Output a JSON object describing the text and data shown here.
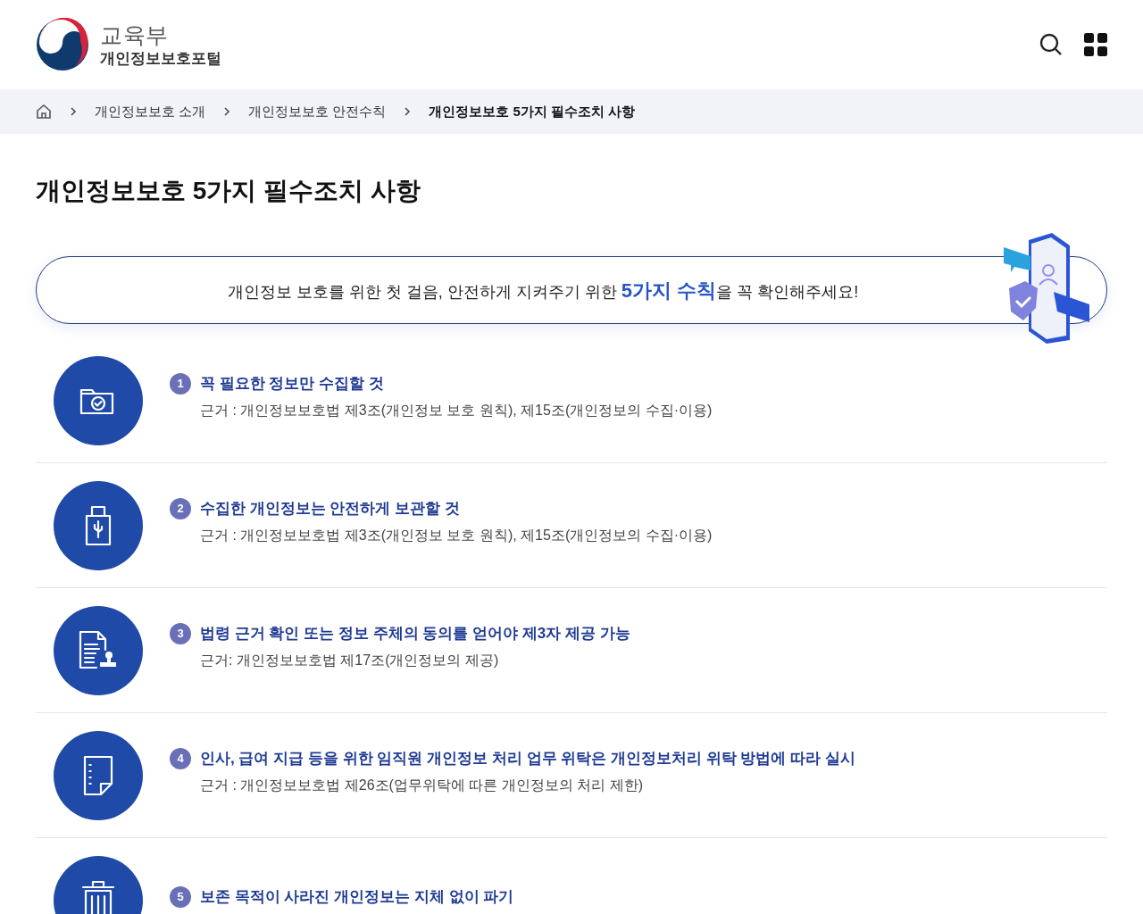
{
  "header": {
    "ministry": "교육부",
    "portal": "개인정보보호포털"
  },
  "breadcrumb": [
    {
      "label": "개인정보보호 소개",
      "current": false
    },
    {
      "label": "개인정보보호 안전수칙",
      "current": false
    },
    {
      "label": "개인정보보호 5가지 필수조치 사항",
      "current": true
    }
  ],
  "title": "개인정보보호 5가지 필수조치 사항",
  "banner": {
    "before": "개인정보 보호를 위한 첫 걸음, 안전하게 지켜주기 위한 ",
    "highlight": "5가지 수칙",
    "after": "을 꼭 확인해주세요!"
  },
  "items": [
    {
      "number": "1",
      "title": "꼭 필요한 정보만 수집할 것",
      "basis": "근거 : 개인정보보호법 제3조(개인정보 보호 원칙), 제15조(개인정보의 수집·이용)"
    },
    {
      "number": "2",
      "title": "수집한 개인정보는 안전하게 보관할 것",
      "basis": "근거 : 개인정보보호법 제3조(개인정보 보호 원칙), 제15조(개인정보의 수집·이용)"
    },
    {
      "number": "3",
      "title": "법령 근거 확인 또는 정보 주체의 동의를 얻어야 제3자 제공 가능",
      "basis": "근거: 개인정보보호법 제17조(개인정보의 제공)"
    },
    {
      "number": "4",
      "title": "인사, 급여 지급 등을 위한 임직원 개인정보 처리 업무 위탁은 개인정보처리 위탁 방법에 따라 실시",
      "basis": "근거 : 개인정보보호법 제26조(업무위탁에 따른 개인정보의 처리 제한)"
    },
    {
      "number": "5",
      "title": "보존 목적이 사라진 개인정보는 지체 없이 파기"
    }
  ]
}
